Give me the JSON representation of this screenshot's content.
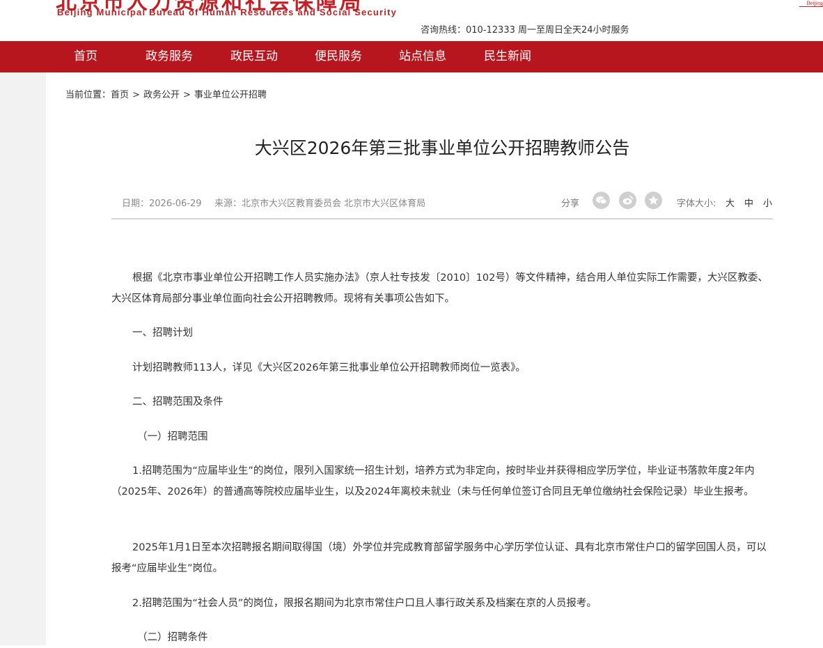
{
  "header": {
    "logo_cn": "北京市人力资源和社会保障局",
    "logo_en": "Beijing Municipal Bureau of Human Resources and Social Security",
    "corner_text": "Beijing",
    "hotline": "咨询热线：010-12333 周一至周日全天24小时服务"
  },
  "nav": {
    "items": [
      "首页",
      "政务服务",
      "政民互动",
      "便民服务",
      "站点信息",
      "民生新闻"
    ]
  },
  "breadcrumb": {
    "prefix": "当前位置：",
    "items": [
      "首页",
      "政务公开",
      "事业单位公开招聘"
    ],
    "separator": ">"
  },
  "article": {
    "title": "大兴区2026年第三批事业单位公开招聘教师公告",
    "date": "日期：2026-06-29",
    "source": "来源：北京市大兴区教育委员会 北京市大兴区体育局",
    "share_label": "分享",
    "font_size_label": "字体大小:",
    "font_sizes": [
      "大",
      "中",
      "小"
    ],
    "paragraphs": [
      "根据《北京市事业单位公开招聘工作人员实施办法》（京人社专技发〔2010〕102号）等文件精神，结合用人单位实际工作需要，大兴区教委、大兴区体育局部分事业单位面向社会公开招聘教师。现将有关事项公告如下。",
      "一、招聘计划",
      "计划招聘教师113人，详见《大兴区2026年第三批事业单位公开招聘教师岗位一览表》。",
      "二、招聘范围及条件",
      "（一）招聘范围",
      "1.招聘范围为“应届毕业生”的岗位，限列入国家统一招生计划，培养方式为非定向，按时毕业并获得相应学历学位，毕业证书落款年度2年内（2025年、2026年）的普通高等院校应届毕业生，以及2024年离校未就业（未与任何单位签订合同且无单位缴纳社会保险记录）毕业生报考。",
      "2025年1月1日至本次招聘报名期间取得国（境）外学位并完成教育部留学服务中心学历学位认证、具有北京市常住户口的留学回国人员，可以报考“应届毕业生”岗位。",
      "2.招聘范围为“社会人员”的岗位，限报名期间为北京市常住户口且人事行政关系及档案在京的人员报考。",
      "（二）招聘条件"
    ]
  },
  "icons": {
    "wechat": "wechat-icon",
    "weibo": "weibo-icon",
    "qzone": "star-icon"
  },
  "colors": {
    "brand_red": "#b8161e",
    "logo_red": "#c41f24"
  }
}
